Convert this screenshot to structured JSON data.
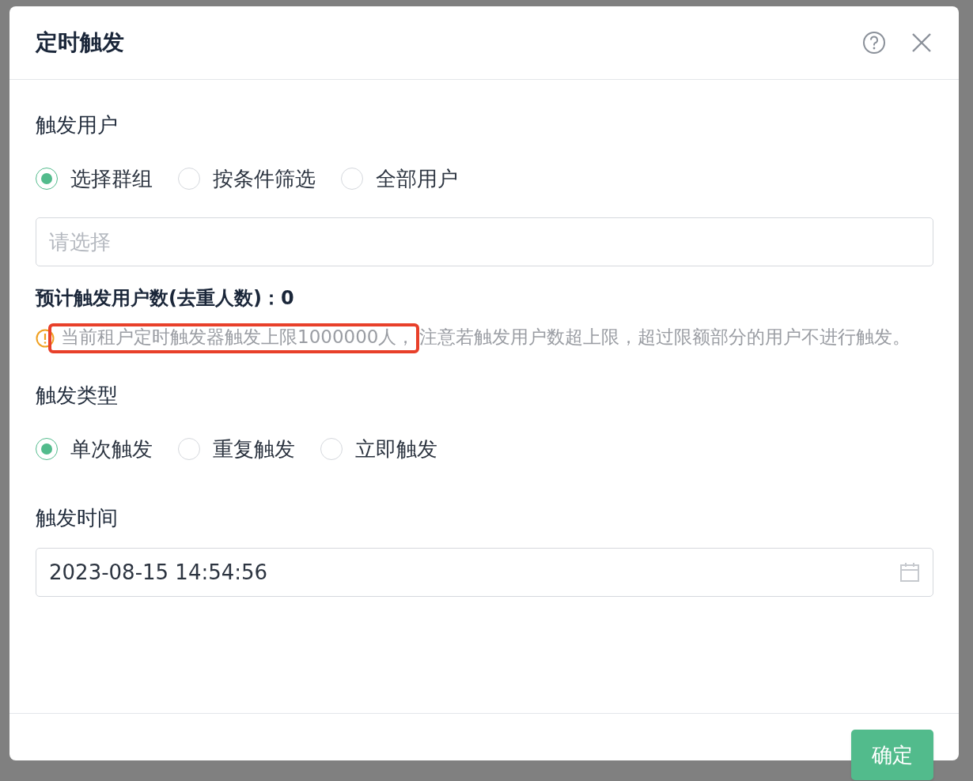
{
  "dialog": {
    "title": "定时触发"
  },
  "user_section": {
    "label": "触发用户",
    "options": [
      {
        "label": "选择群组",
        "selected": true
      },
      {
        "label": "按条件筛选",
        "selected": false
      },
      {
        "label": "全部用户",
        "selected": false
      }
    ],
    "select": {
      "placeholder": "请选择"
    },
    "estimate": "预计触发用户数(去重人数)：0",
    "warning": {
      "highlighted": "当前租户定时触发器触发上限1000000人，",
      "text": "注意若触发用户数超上限，超过限额部分的用户不进行触发。"
    }
  },
  "type_section": {
    "label": "触发类型",
    "options": [
      {
        "label": "单次触发",
        "selected": true
      },
      {
        "label": "重复触发",
        "selected": false
      },
      {
        "label": "立即触发",
        "selected": false
      }
    ]
  },
  "time_section": {
    "label": "触发时间",
    "value": "2023-08-15 14:54:56"
  },
  "footer": {
    "confirm": "确定"
  }
}
